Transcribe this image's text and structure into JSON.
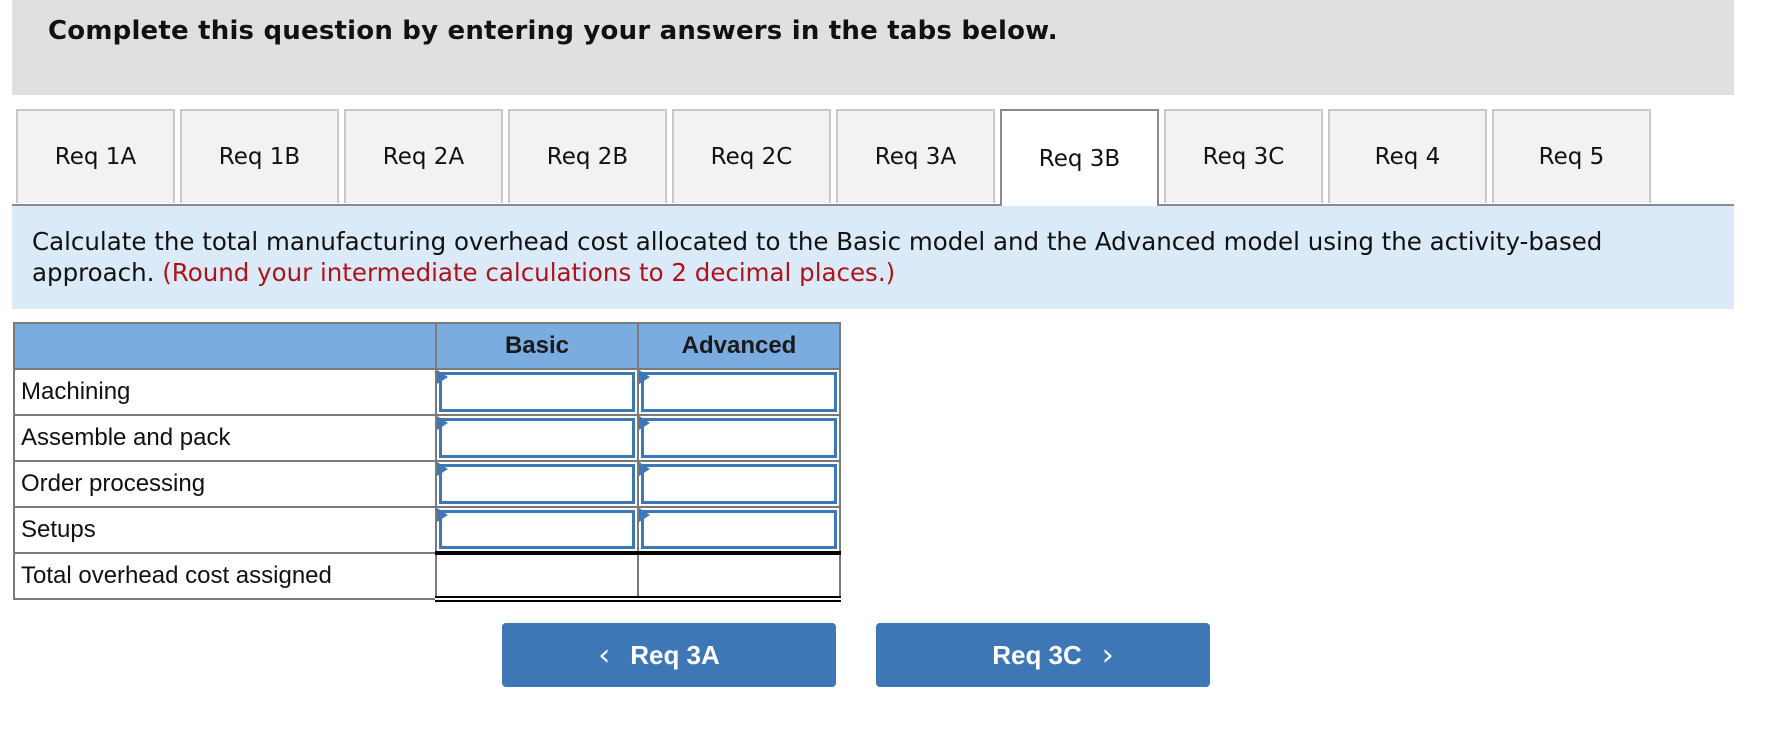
{
  "header": {
    "title": "Complete this question by entering your answers in the tabs below."
  },
  "tabs": [
    {
      "label": "Req 1A",
      "active": false
    },
    {
      "label": "Req 1B",
      "active": false
    },
    {
      "label": "Req 2A",
      "active": false
    },
    {
      "label": "Req 2B",
      "active": false
    },
    {
      "label": "Req 2C",
      "active": false
    },
    {
      "label": "Req 3A",
      "active": false
    },
    {
      "label": "Req 3B",
      "active": true
    },
    {
      "label": "Req 3C",
      "active": false
    },
    {
      "label": "Req 4",
      "active": false
    },
    {
      "label": "Req 5",
      "active": false
    }
  ],
  "instructions": {
    "text": "Calculate the total manufacturing overhead cost allocated to the Basic model and the Advanced model using the activity-based approach. ",
    "note": "(Round your intermediate calculations to 2 decimal places.)"
  },
  "table": {
    "columns": [
      "",
      "Basic",
      "Advanced"
    ],
    "rows": [
      {
        "label": "Machining",
        "basic": "",
        "advanced": ""
      },
      {
        "label": "Assemble and pack",
        "basic": "",
        "advanced": ""
      },
      {
        "label": "Order processing",
        "basic": "",
        "advanced": ""
      },
      {
        "label": "Setups",
        "basic": "",
        "advanced": ""
      }
    ],
    "total": {
      "label": "Total overhead cost assigned",
      "basic": "",
      "advanced": ""
    }
  },
  "nav": {
    "prev_label": "Req 3A",
    "next_label": "Req 3C",
    "prev_icon": "‹",
    "next_icon": "›"
  },
  "colors": {
    "accent": "#3d77b6",
    "table_header": "#7aace0",
    "instruction_bg": "#dbeaf8",
    "note_red": "#b0121b"
  }
}
